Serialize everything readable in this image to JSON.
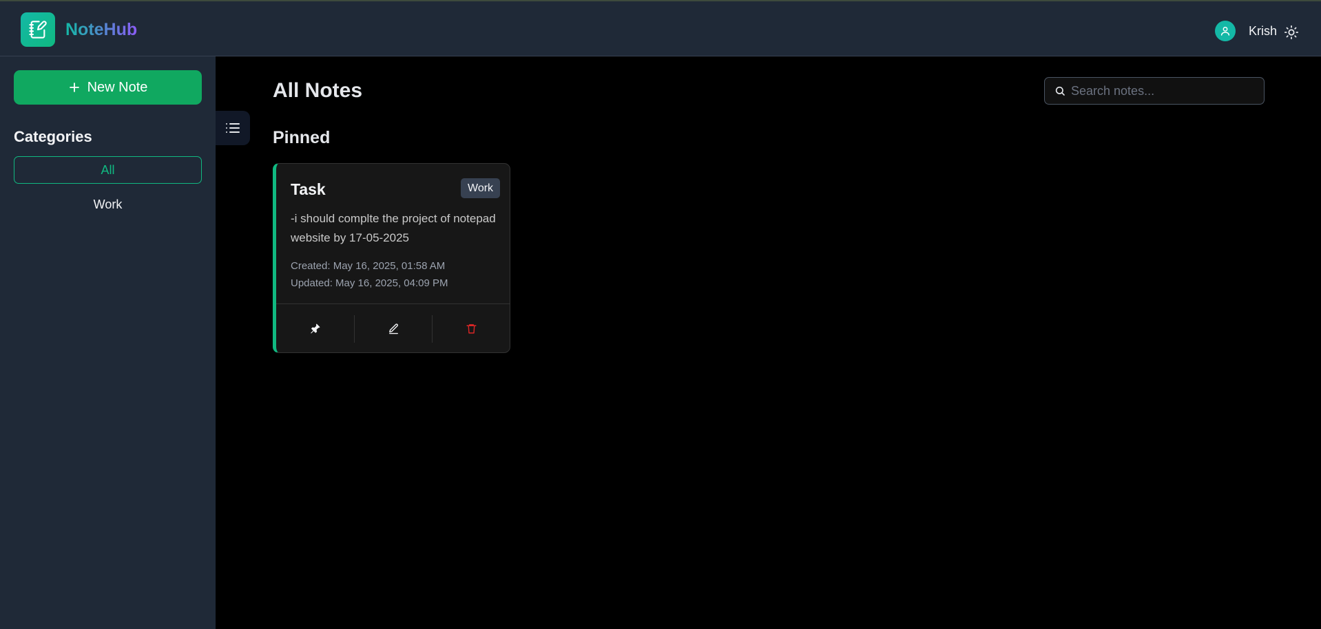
{
  "app": {
    "name": "NoteHub"
  },
  "header": {
    "username": "Krish"
  },
  "sidebar": {
    "new_note_label": "New Note",
    "categories_title": "Categories",
    "categories": [
      {
        "label": "All",
        "selected": true
      },
      {
        "label": "Work",
        "selected": false
      }
    ]
  },
  "main": {
    "title": "All Notes",
    "search": {
      "placeholder": "Search notes...",
      "value": ""
    },
    "sections": [
      {
        "title": "Pinned",
        "notes": [
          {
            "title": "Task",
            "tag": "Work",
            "content": "-i should complte the project of notepad website by 17-05-2025",
            "created": "Created: May 16, 2025, 01:58 AM",
            "updated": "Updated: May 16, 2025, 04:09 PM",
            "accent_color": "#10b981"
          }
        ]
      }
    ]
  },
  "colors": {
    "accent": "#10b981",
    "primary_button": "#10a860",
    "danger": "#dc2626",
    "sidebar_bg": "#1f2937",
    "main_bg": "#000000"
  },
  "icons": {
    "logo": "notebook-pen-icon",
    "avatar": "user-icon",
    "theme": "sun-icon",
    "new_note": "plus-icon",
    "toggle": "list-icon",
    "search": "search-icon",
    "pin": "pin-icon",
    "edit": "pencil-icon",
    "delete": "trash-icon"
  }
}
